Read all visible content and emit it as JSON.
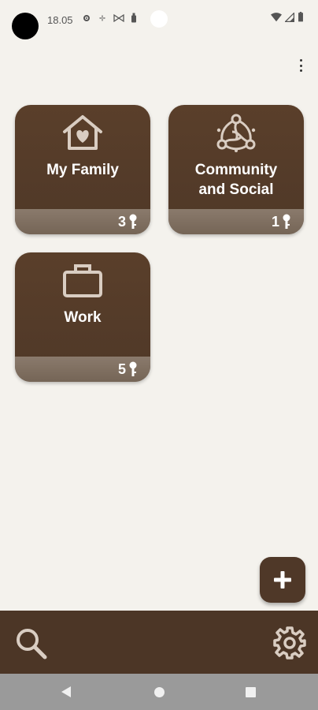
{
  "status_bar": {
    "time": "18.05",
    "left_icons": [
      "settings-gear-icon",
      "fan-icon",
      "pinwheel-icon",
      "bottle-icon"
    ],
    "right_icons": [
      "wifi-icon",
      "signal-icon",
      "battery-icon"
    ]
  },
  "app_bar": {
    "menu_icon": "more-vert-icon"
  },
  "categories": [
    {
      "label_line1": "My Family",
      "label_line2": "",
      "count": "3",
      "icon": "house-heart-icon"
    },
    {
      "label_line1": "Community",
      "label_line2": "and Social",
      "count": "1",
      "icon": "community-network-icon"
    },
    {
      "label_line1": "Work",
      "label_line2": "",
      "count": "5",
      "icon": "briefcase-icon"
    }
  ],
  "fab": {
    "icon": "plus-icon"
  },
  "bottom_bar": {
    "left_icon": "search-icon",
    "right_icon": "settings-icon"
  },
  "colors": {
    "background": "#f4f2ed",
    "tile": "#56402c",
    "tile_footer": "#806f61",
    "bottom_bar": "#4c3626",
    "nav_bar": "#9a9a9a"
  }
}
